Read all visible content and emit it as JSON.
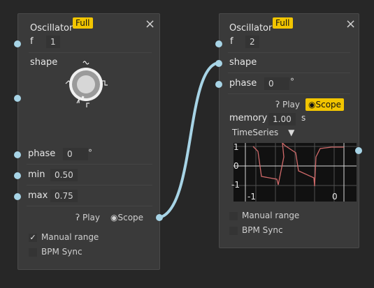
{
  "node1": {
    "title": "Oscillator",
    "badge": "Full",
    "close_icon": "×",
    "f_label": "f",
    "f_value": "1",
    "shape_label": "shape",
    "phase_label": "phase",
    "phase_value": "0",
    "phase_unit": "°",
    "min_label": "min",
    "min_value": "0.50",
    "max_label": "max",
    "max_value": "0.75",
    "play_label": "Play",
    "scope_label": "Scope",
    "manual_range_label": "Manual range",
    "manual_range_checked": true,
    "bpm_sync_label": "BPM Sync",
    "bpm_sync_checked": false
  },
  "node2": {
    "title": "Oscillator",
    "badge": "Full",
    "close_icon": "×",
    "f_label": "f",
    "f_value": "2",
    "shape_label": "shape",
    "phase_label": "phase",
    "phase_value": "0",
    "phase_unit": "°",
    "play_label": "Play",
    "scope_label": "Scope",
    "memory_label": "memory",
    "memory_value": "1.00",
    "memory_unit": "s",
    "view_select": "TimeSeries",
    "plot_y_ticks": [
      "1",
      "0",
      "-1"
    ],
    "plot_x_ticks": [
      "-1",
      "0"
    ],
    "manual_range_label": "Manual range",
    "manual_range_checked": false,
    "bpm_sync_label": "BPM Sync",
    "bpm_sync_checked": false
  },
  "colors": {
    "accent": "#f2c500",
    "wire": "#a7d4e6",
    "signal": "#d06a6a"
  }
}
